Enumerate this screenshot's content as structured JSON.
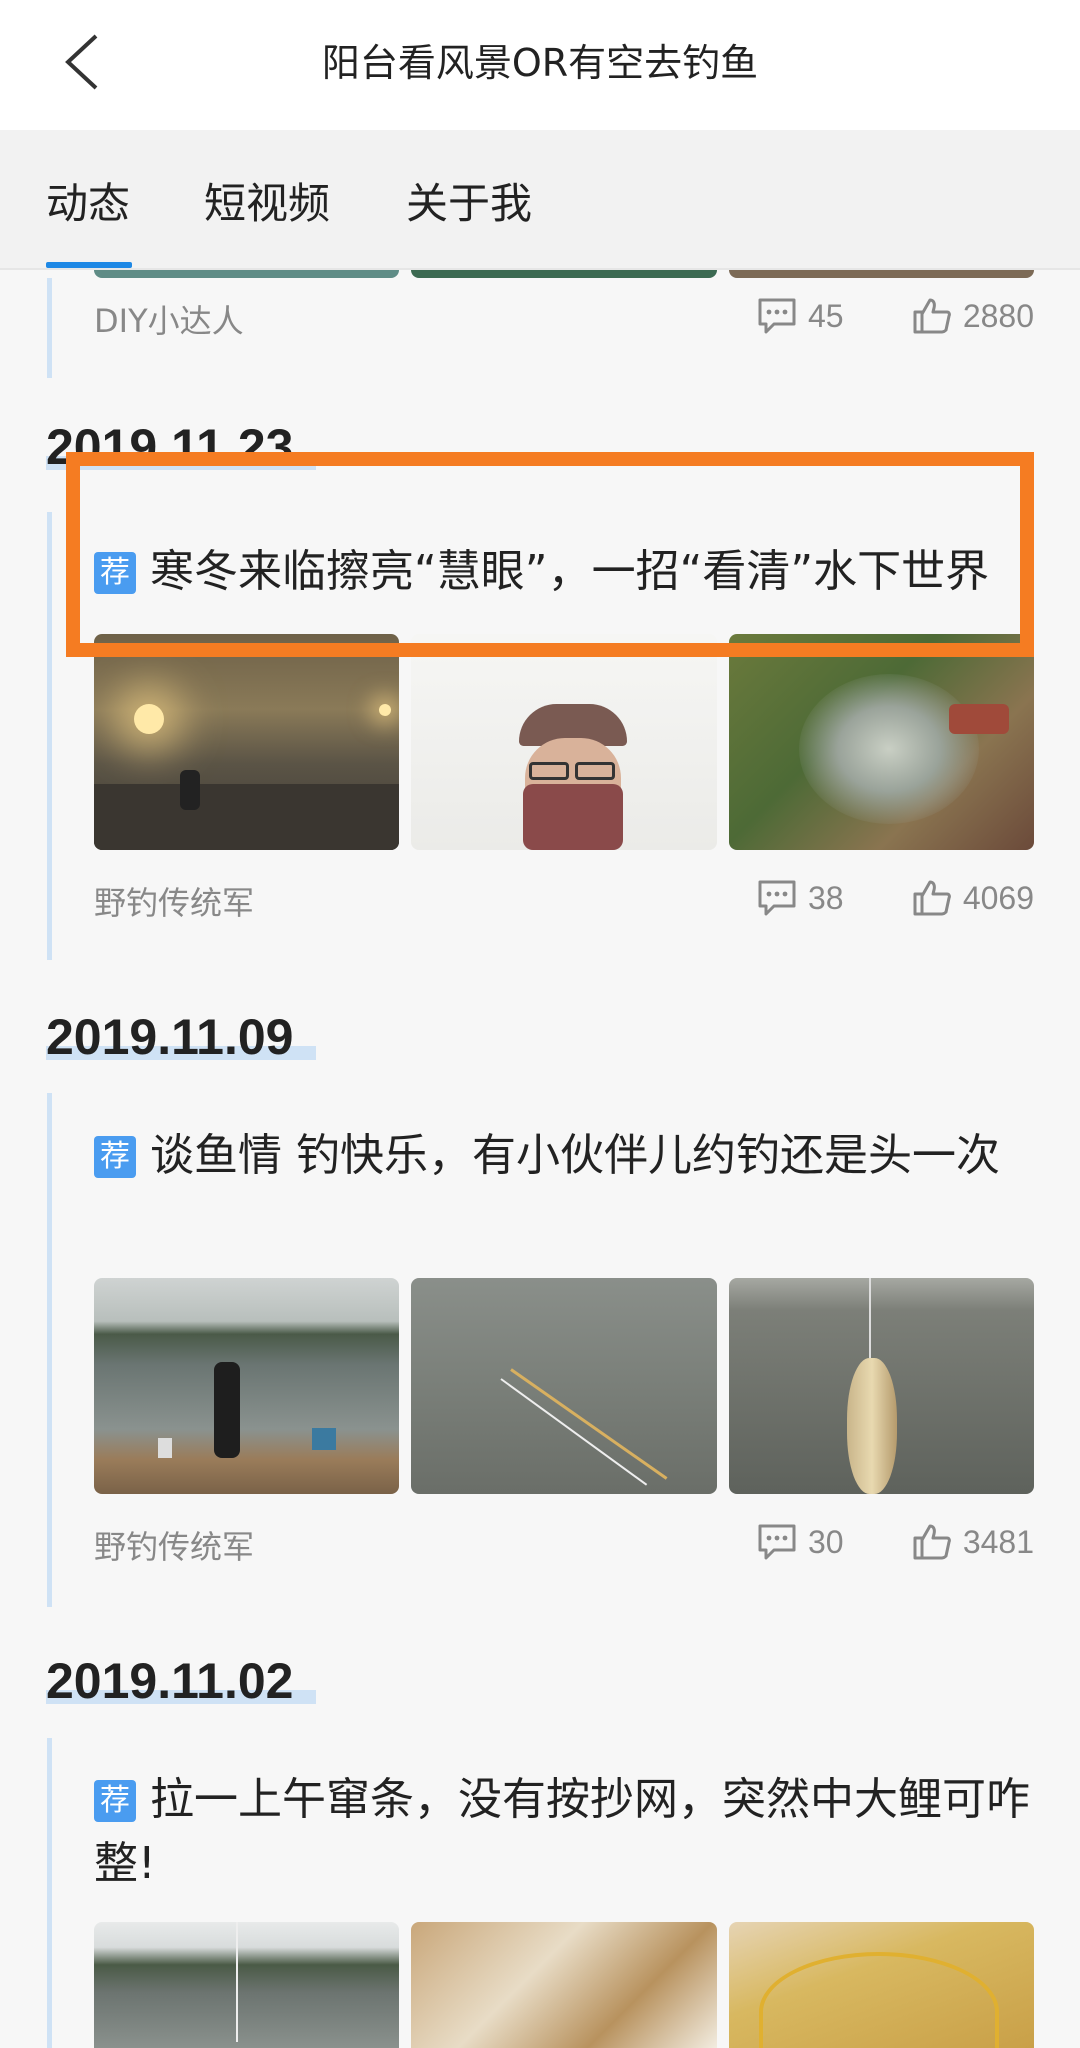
{
  "header": {
    "title": "阳台看风景OR有空去钓鱼"
  },
  "tabs": [
    {
      "label": "动态",
      "active": true
    },
    {
      "label": "短视频"
    },
    {
      "label": "关于我"
    }
  ],
  "top_post": {
    "author": "DIY小达人",
    "comments": "45",
    "likes": "2880"
  },
  "posts": [
    {
      "date": "2019.11.23",
      "badge": "荐",
      "title": "寒冬来临擦亮“慧眼”，一招“看清”水下世界",
      "author": "野钓传统军",
      "comments": "38",
      "likes": "4069"
    },
    {
      "date": "2019.11.09",
      "badge": "荐",
      "title": "谈鱼情 钓快乐，有小伙伴儿约钓还是头一次",
      "author": "野钓传统军",
      "comments": "30",
      "likes": "3481"
    },
    {
      "date": "2019.11.02",
      "badge": "荐",
      "title": "拉一上午窜条，没有按抄网，突然中大鲤可咋整!"
    }
  ],
  "colors": {
    "accent": "#1e88e5",
    "badge": "#4a9cf0",
    "highlight": "#f57c22",
    "timeline": "#cfe2f5"
  }
}
